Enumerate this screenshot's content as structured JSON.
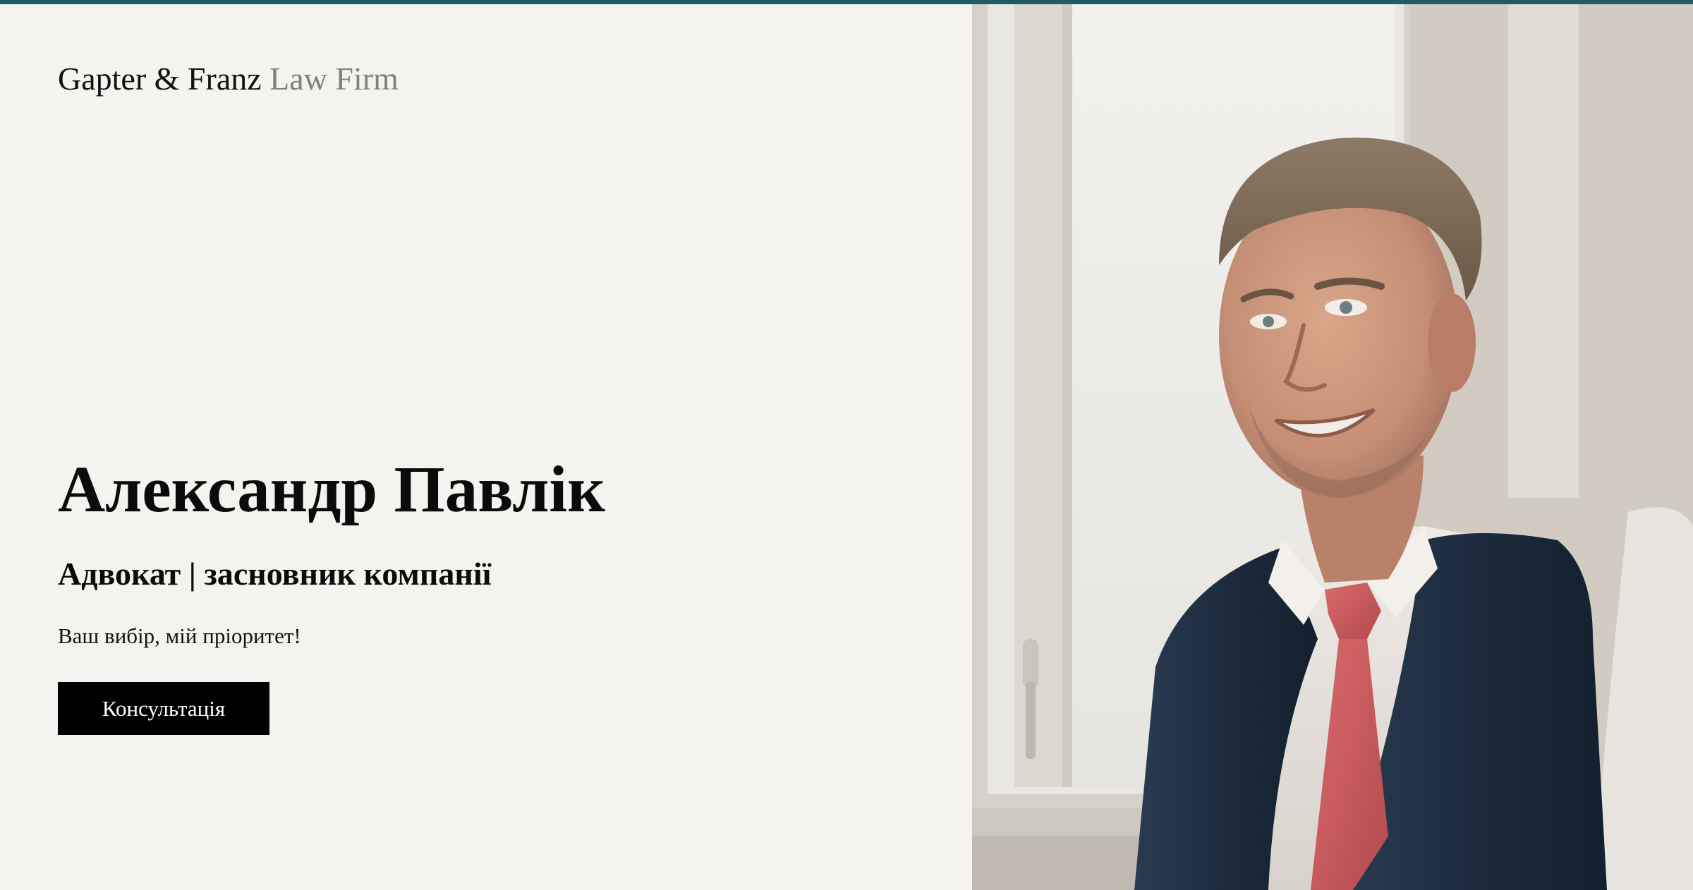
{
  "brand": {
    "name_main": "Gapter & Franz",
    "name_sub": "Law Firm"
  },
  "hero": {
    "name": "Александр Павлік",
    "role": "Адвокат | засновник компанії",
    "tagline": "Ваш вибір, мій пріоритет!",
    "cta_label": "Консультація"
  },
  "colors": {
    "accent_bar": "#1f5c63",
    "background": "#f5f3ef",
    "button_bg": "#000000",
    "button_text": "#ffffff",
    "brand_sub": "#808080"
  },
  "photo": {
    "subject": "portrait-of-smiling-man-in-vest-and-red-tie"
  }
}
